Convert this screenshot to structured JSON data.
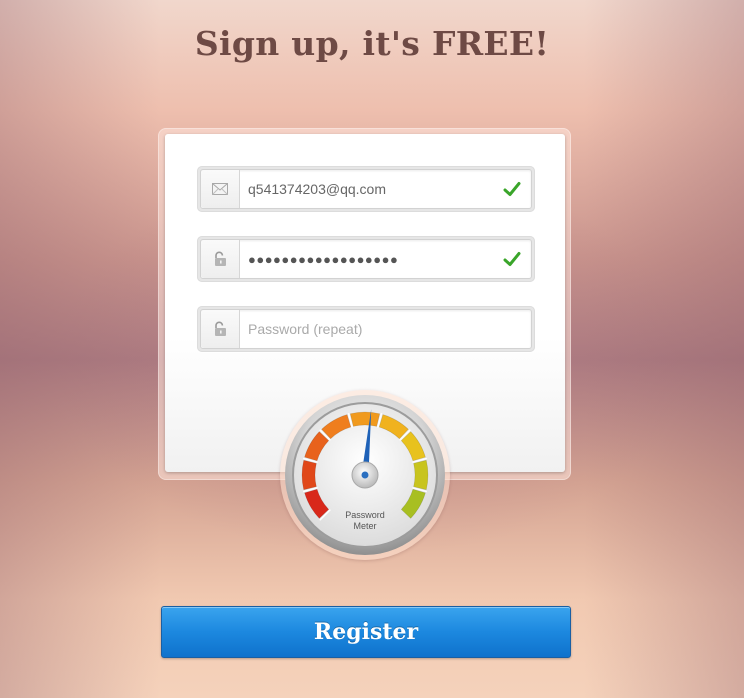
{
  "page": {
    "title": "Sign up, it's FREE!"
  },
  "form": {
    "email": {
      "value": "q541374203@qq.com",
      "icon": "envelope-icon",
      "valid": true
    },
    "password": {
      "value": "●●●●●●●●●●●●●●●●●●",
      "icon": "unlock-icon",
      "valid": true
    },
    "password_repeat": {
      "placeholder": "Password (repeat)",
      "icon": "unlock-icon"
    }
  },
  "meter": {
    "label_line1": "Password",
    "label_line2": "Meter",
    "level": 0.52
  },
  "register_label": "Register",
  "colors": {
    "title": "#6e4a45",
    "check": "#3aa52a",
    "button": "#1c88df"
  }
}
